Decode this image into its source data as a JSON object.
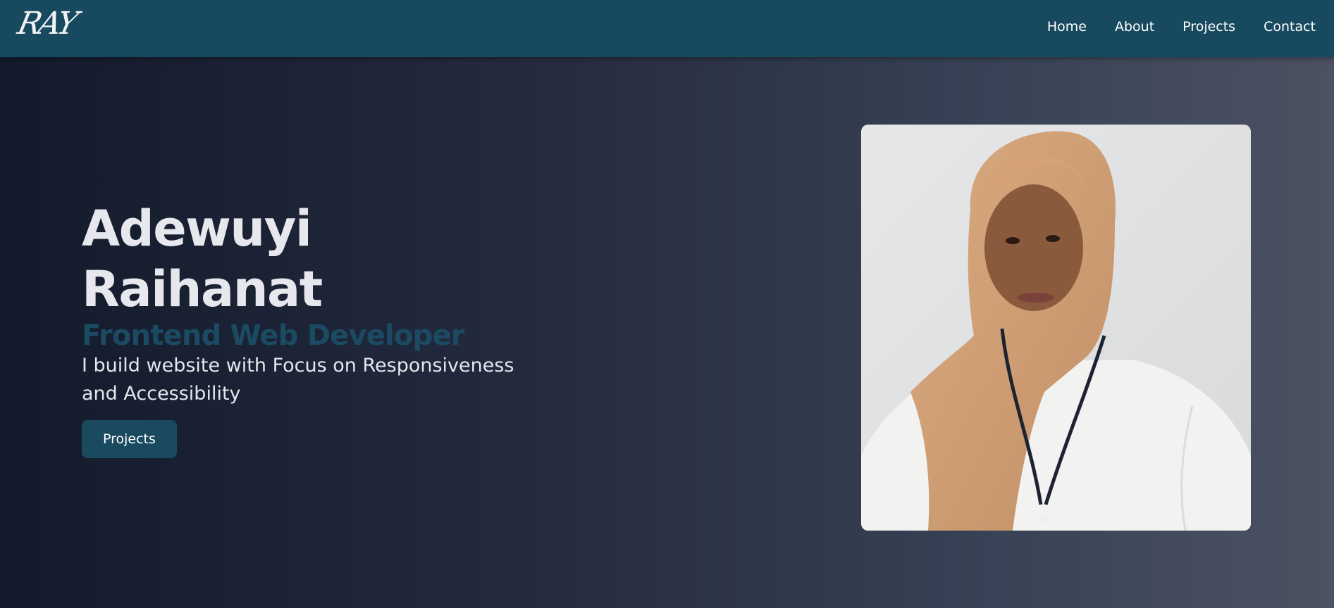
{
  "logo": {
    "text": "RAY"
  },
  "nav": {
    "items": [
      "Home",
      "About",
      "Projects",
      "Contact"
    ]
  },
  "hero": {
    "name": "Adewuyi Raihanat",
    "role": "Frontend Web Developer",
    "description": "I build website with Focus on Responsiveness and Accessibility",
    "button_label": "Projects"
  },
  "colors": {
    "navbar": "#17495f",
    "accent": "#1a4b62",
    "button": "#1a4a5f",
    "background_start": "#121a2b",
    "background_end": "#4b5262"
  },
  "images": {
    "portrait": "portrait-photo"
  }
}
